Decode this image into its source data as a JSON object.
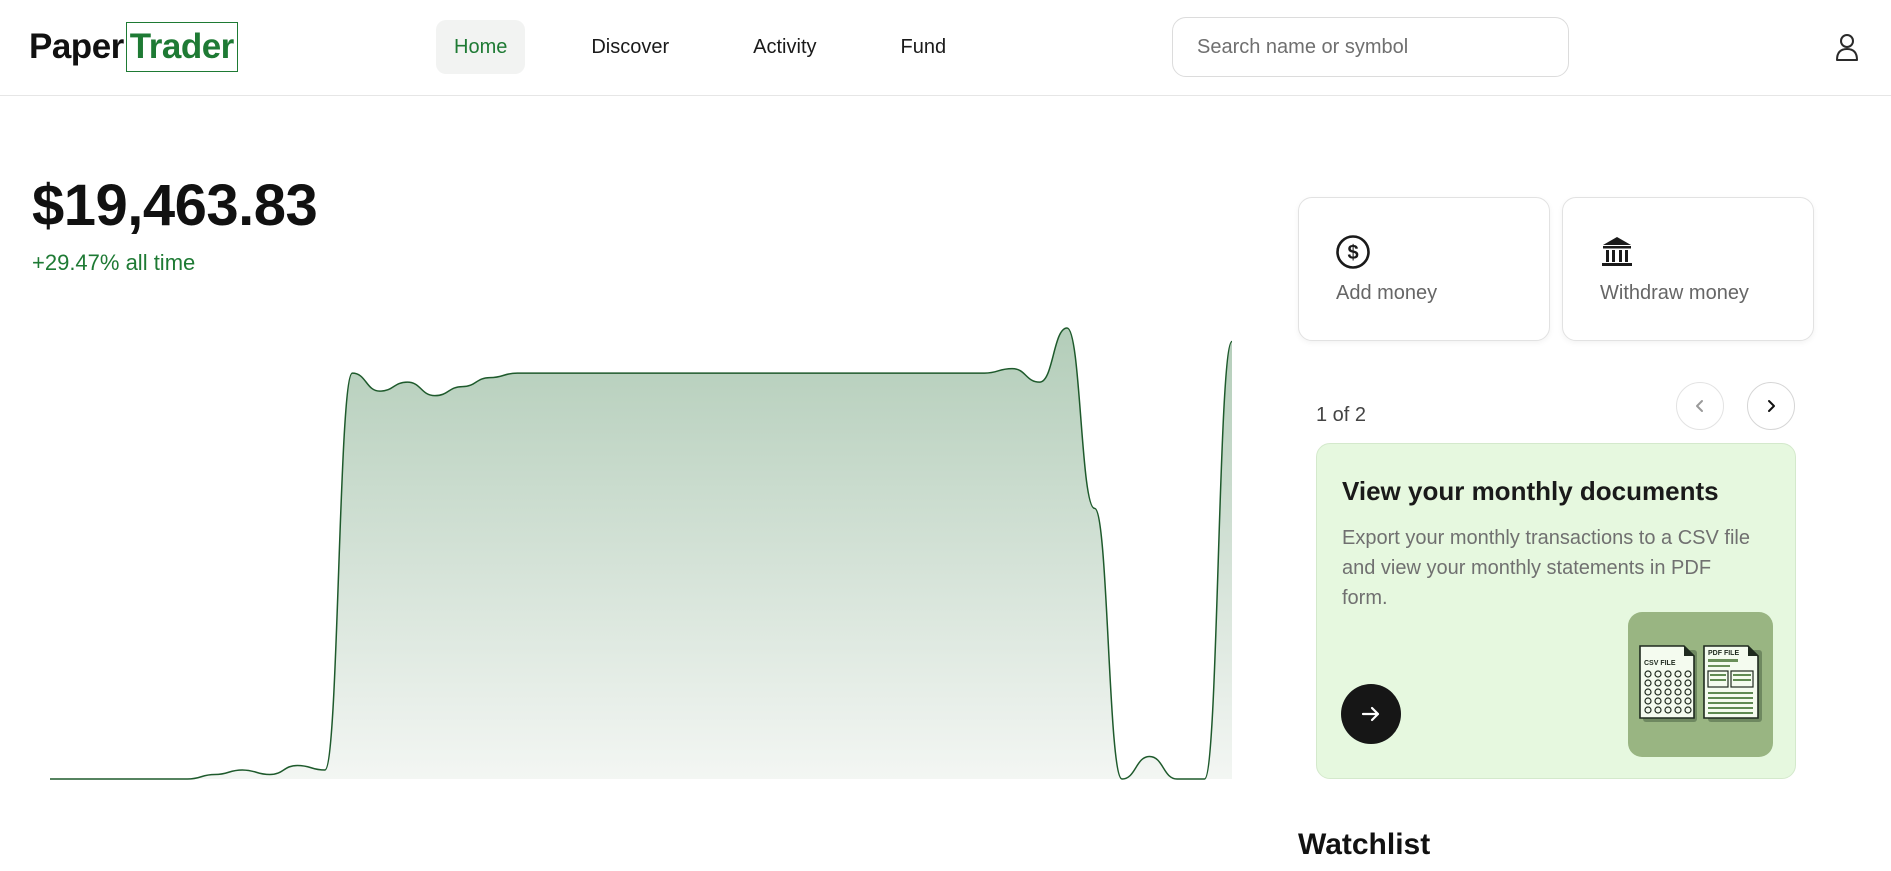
{
  "brand": {
    "part1": "Paper",
    "part2": "Trader"
  },
  "nav": {
    "items": [
      {
        "label": "Home",
        "active": true
      },
      {
        "label": "Discover",
        "active": false
      },
      {
        "label": "Activity",
        "active": false
      },
      {
        "label": "Fund",
        "active": false
      }
    ]
  },
  "search": {
    "placeholder": "Search name or symbol",
    "value": ""
  },
  "user": {
    "icon": "user-icon"
  },
  "portfolio": {
    "balance": "$19,463.83",
    "change": "+29.47% all time"
  },
  "actions": {
    "add": {
      "label": "Add money",
      "icon": "dollar-circle-icon"
    },
    "withdraw": {
      "label": "Withdraw money",
      "icon": "bank-icon"
    }
  },
  "pager": {
    "text": "1 of 2",
    "prev_icon": "chevron-left-icon",
    "next_icon": "chevron-right-icon"
  },
  "promo": {
    "title": "View your monthly documents",
    "body": "Export your monthly transactions to a CSV file and view your monthly statements in PDF form.",
    "action_icon": "arrow-right-icon",
    "art": {
      "csv_label": "CSV FILE",
      "pdf_label": "PDF FILE"
    }
  },
  "watchlist": {
    "title": "Watchlist"
  },
  "colors": {
    "brand_green": "#1e7a34",
    "chart_fill": "#b3cdb9",
    "promo_bg": "#e6f8df",
    "promo_art_bg": "#99b582"
  },
  "chart_data": {
    "type": "area",
    "series": [
      {
        "values": [
          0,
          0,
          0,
          0,
          0,
          0,
          0.01,
          0.02,
          0.01,
          0.03,
          0.02,
          0.9,
          0.86,
          0.88,
          0.85,
          0.87,
          0.89,
          0.9,
          0.9,
          0.9,
          0.9,
          0.9,
          0.9,
          0.9,
          0.9,
          0.9,
          0.9,
          0.9,
          0.9,
          0.9,
          0.9,
          0.9,
          0.9,
          0.9,
          0.9,
          0.91,
          0.88,
          1.0,
          0.6,
          0.0,
          0.05,
          0.0,
          0.0,
          0.97
        ]
      }
    ],
    "xlabel": "",
    "ylabel": "",
    "grid": false,
    "legend": "none"
  }
}
